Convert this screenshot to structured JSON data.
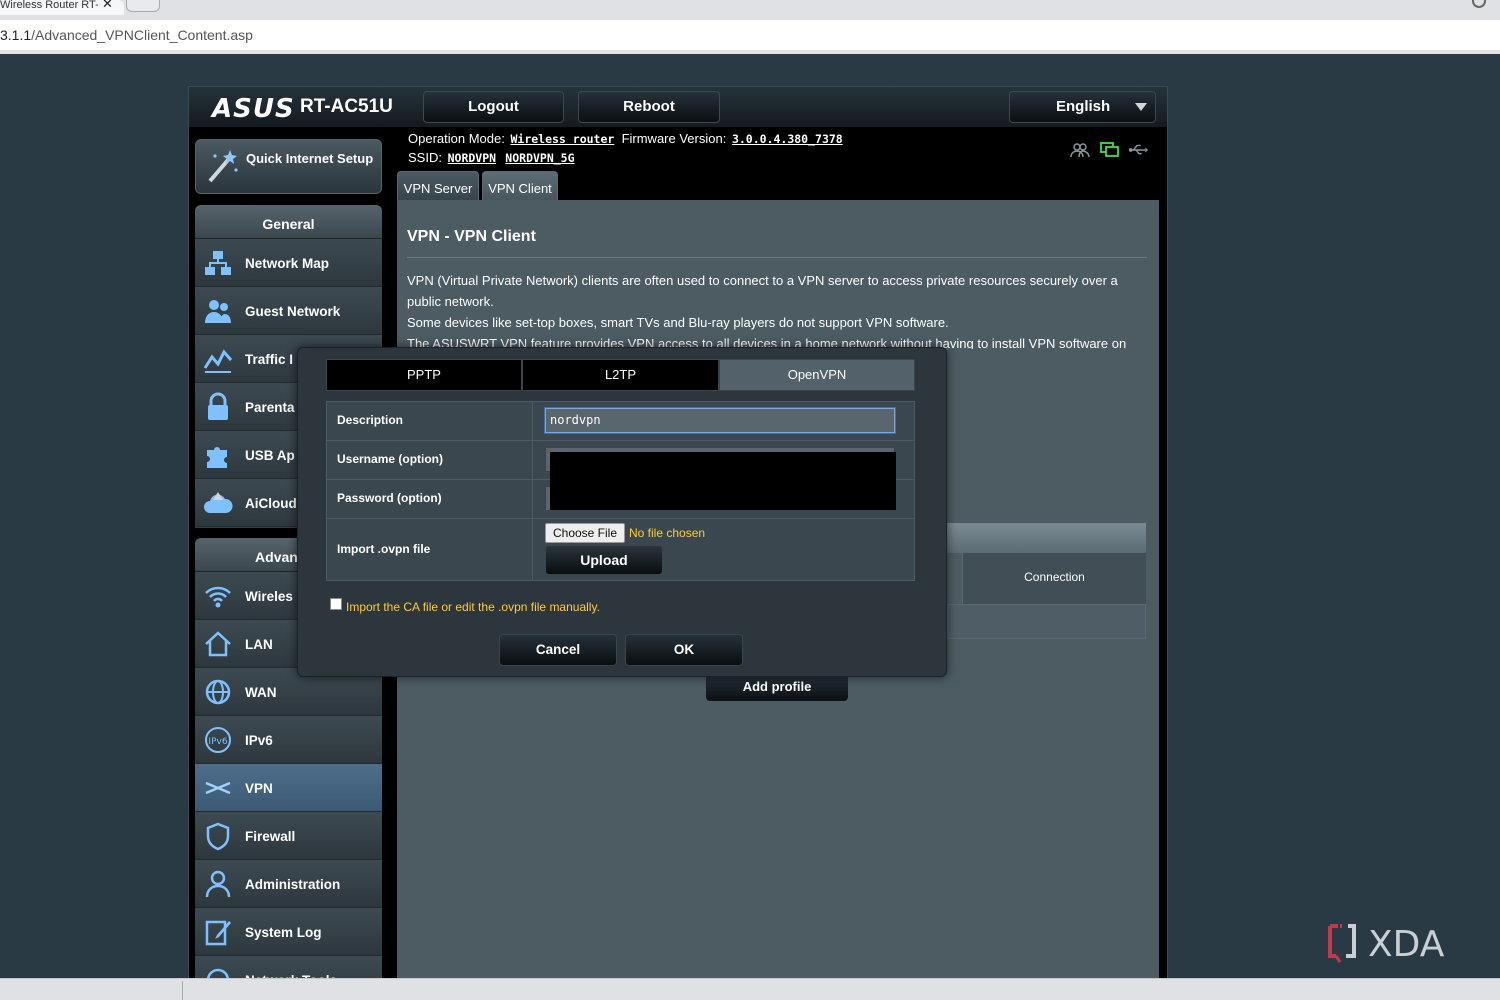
{
  "browser": {
    "tab_title": "Wireless Router RT-",
    "url_prefix": "3.1.1",
    "url_path": "/Advanced_VPNClient_Content.asp"
  },
  "header": {
    "brand": "ASUS",
    "model": "RT-AC51U",
    "logout_label": "Logout",
    "reboot_label": "Reboot",
    "language": "English"
  },
  "status": {
    "operation_mode_label": "Operation Mode:",
    "operation_mode": "Wireless router",
    "firmware_label": "Firmware Version:",
    "firmware_version": "3.0.0.4.380_7378",
    "ssid_label": "SSID:",
    "ssid_1": "NORDVPN",
    "ssid_2": "NORDVPN_5G",
    "icons": [
      "clients-icon",
      "network-status-icon",
      "usb-icon"
    ]
  },
  "sidebar": {
    "quick_setup_label": "Quick Internet Setup",
    "general_heading": "General",
    "general_items": [
      {
        "label": "Network Map",
        "icon": "network-map-icon"
      },
      {
        "label": "Guest Network",
        "icon": "guest-network-icon"
      },
      {
        "label": "Traffic I",
        "icon": "traffic-icon"
      },
      {
        "label": "Parenta",
        "icon": "lock-icon"
      },
      {
        "label": "USB Ap",
        "icon": "puzzle-icon"
      },
      {
        "label": "AiCloud",
        "icon": "cloud-icon"
      }
    ],
    "advanced_heading": "Advanced",
    "advanced_items": [
      {
        "label": "Wireles",
        "icon": "wifi-icon"
      },
      {
        "label": "LAN",
        "icon": "home-icon"
      },
      {
        "label": "WAN",
        "icon": "globe-icon"
      },
      {
        "label": "IPv6",
        "icon": "ipv6-icon"
      },
      {
        "label": "VPN",
        "icon": "vpn-icon",
        "active": true
      },
      {
        "label": "Firewall",
        "icon": "shield-icon"
      },
      {
        "label": "Administration",
        "icon": "admin-icon"
      },
      {
        "label": "System Log",
        "icon": "log-icon"
      },
      {
        "label": "Network Tools",
        "icon": "tools-icon"
      }
    ]
  },
  "main": {
    "tabs": [
      {
        "label": "VPN Server"
      },
      {
        "label": "VPN Client",
        "selected": true
      }
    ],
    "title": "VPN - VPN Client",
    "desc_1": "VPN (Virtual Private Network) clients are often used to connect to a VPN server to access private resources securely over a public network.",
    "desc_2": "Some devices like set-top boxes, smart TVs and Blu-ray players do not support VPN software.",
    "desc_3": "The ASUSWRT VPN feature provides VPN access to all devices in a home network without having to install VPN software on",
    "connection_header": "Connection",
    "add_profile_label": "Add profile"
  },
  "modal": {
    "protocol_tabs": [
      "PPTP",
      "L2TP",
      "OpenVPN"
    ],
    "selected_protocol": "OpenVPN",
    "description_label": "Description",
    "description_value": "nordvpn",
    "username_label": "Username (option)",
    "password_label": "Password (option)",
    "import_label": "Import .ovpn file",
    "choose_file_label": "Choose File",
    "no_file_text": "No file chosen",
    "upload_label": "Upload",
    "manual_checkbox_label": "Import the CA file or edit the .ovpn file manually.",
    "manual_checkbox_checked": false,
    "cancel_label": "Cancel",
    "ok_label": "OK"
  },
  "watermark": {
    "text": "XDA"
  },
  "colors": {
    "accent_yellow": "#ffcc33",
    "active_nav": "#4d6d8a",
    "panel": "#4d5b63"
  }
}
